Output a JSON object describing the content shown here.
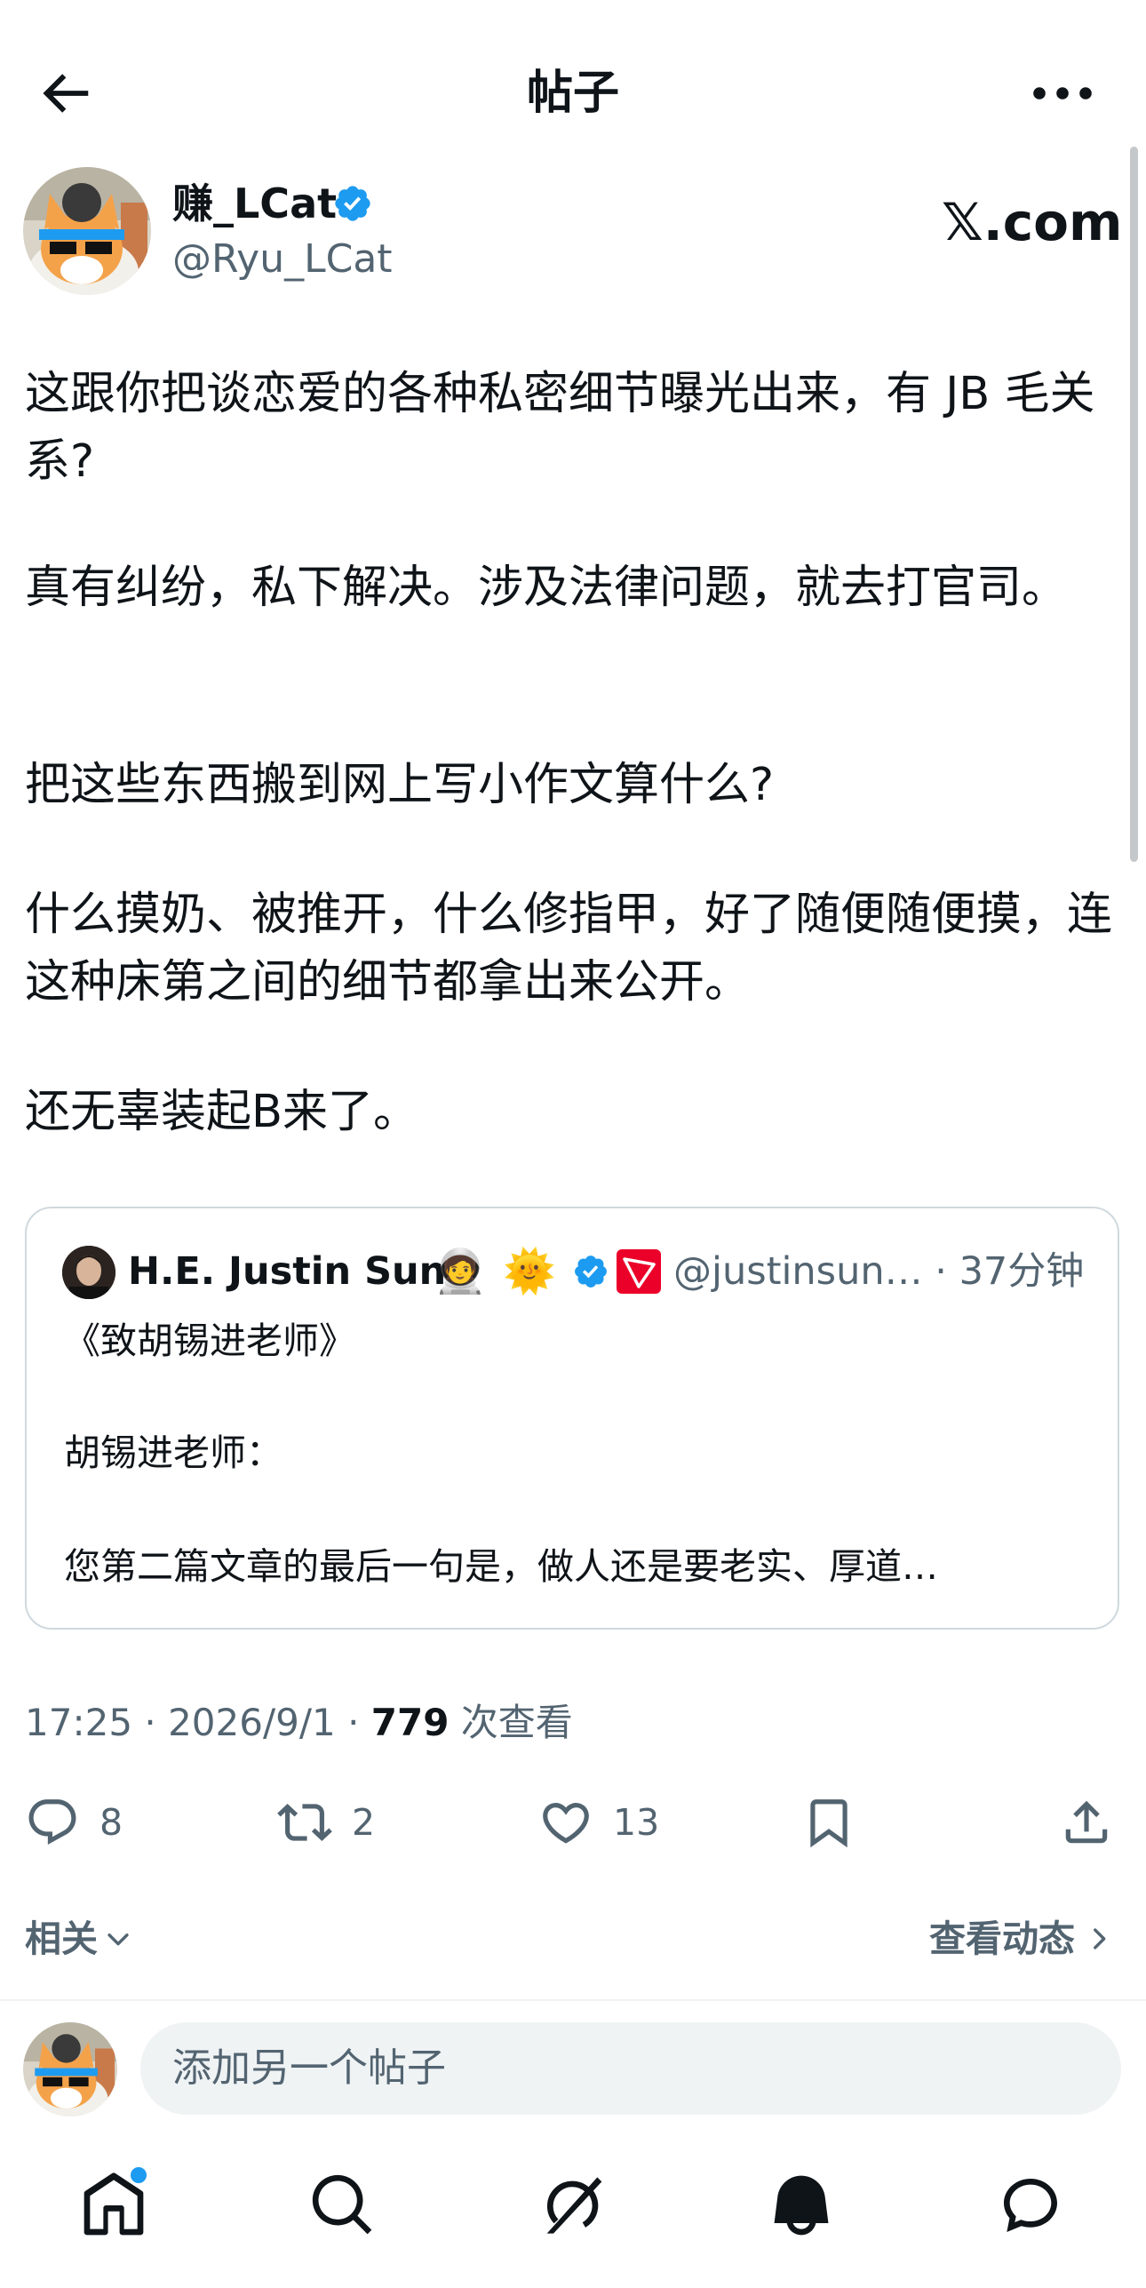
{
  "header": {
    "title": "帖子"
  },
  "post": {
    "author_name": "赚_LCat",
    "author_handle": "@Ryu_LCat",
    "source_logo": "𝕏.com",
    "paragraphs": [
      "这跟你把谈恋爱的各种私密细节曝光出来，有 JB 毛关系?",
      "真有纠纷，私下解决。涉及法律问题，就去打官司。",
      "把这些东西搬到网上写小作文算什么?",
      "什么摸奶、被推开，什么修指甲，好了随便随便摸，连这种床第之间的细节都拿出来公开。",
      "还无辜装起B来了。"
    ],
    "quote": {
      "name": "H.E. Justin Sun",
      "emoji_1": "🧑‍🚀",
      "emoji_2": "🌞",
      "handle_time": "@justinsun… · 37分钟",
      "title": "《致胡锡进老师》",
      "salutation": "胡锡进老师：",
      "excerpt": "您第二篇文章的最后一句是，做人还是要老实、厚道…"
    },
    "meta_prefix": "17:25 · 2026/9/1 · ",
    "views_count": "779",
    "views_label": " 次查看",
    "counts": {
      "replies": "8",
      "reposts": "2",
      "likes": "13"
    }
  },
  "related": {
    "label": "相关",
    "view_activity": "查看动态"
  },
  "composer": {
    "placeholder": "添加另一个帖子"
  },
  "colors": {
    "accent": "#1d9bf0",
    "secondary_text": "#536471",
    "tron_red": "#eb0029"
  },
  "icons": [
    "back-arrow-icon",
    "more-icon",
    "verified-badge-icon",
    "reply-icon",
    "repost-icon",
    "like-icon",
    "bookmark-icon",
    "share-icon",
    "home-icon",
    "search-icon",
    "grok-icon",
    "notifications-icon",
    "messages-icon"
  ]
}
